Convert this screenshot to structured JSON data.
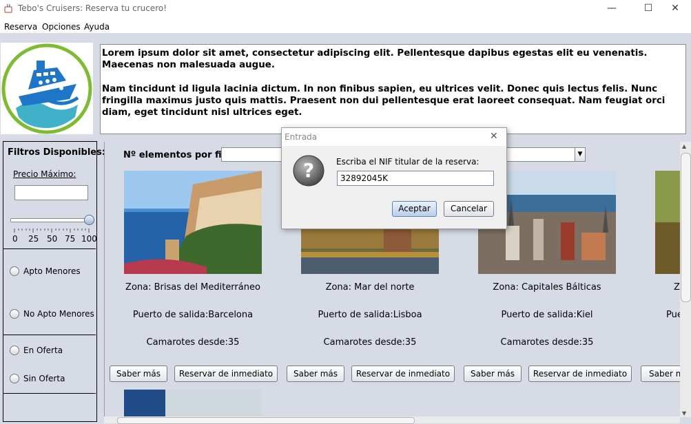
{
  "window": {
    "title": "Tebo's Cruisers: Reserva tu crucero!",
    "minimize": "—",
    "maximize": "☐",
    "close": "✕"
  },
  "menu": [
    "Reserva",
    "Opciones",
    "Ayuda"
  ],
  "description": [
    "Lorem ipsum dolor sit amet, consectetur adipiscing elit. Pellentesque dapibus egestas elit eu venenatis. Maecenas non malesuada augue.",
    "Nam tincidunt id ligula lacinia dictum. In non finibus sapien, eu ultrices velit. Donec quis lectus felis. Nunc fringilla maximus justo quis mattis. Praesent non dui pellentesque erat laoreet consequat. Nam feugiat orci diam, eget tincidunt nisl ultrices eget."
  ],
  "filters": {
    "title": "Filtros Disponibles:",
    "price_label": "Precio Máximo:",
    "price_value": "",
    "slider_ticks": [
      "0",
      "25",
      "50",
      "75",
      "100"
    ],
    "slider_value": 100,
    "apto": "Apto Menores",
    "no_apto": "No Apto Menores",
    "en_oferta": "En Oferta",
    "sin_oferta": "Sin Oferta"
  },
  "main": {
    "rows_label": "Nº elementos por fila",
    "rows_value": "",
    "combo_value": ""
  },
  "cards": [
    {
      "zona": "Zona: Brisas del Mediterráneo",
      "puerto": "Puerto de salida:Barcelona",
      "camarotes": "Camarotes desde:35",
      "saber": "Saber más",
      "reservar": "Reservar de inmediato"
    },
    {
      "zona": "Zona: Mar del norte",
      "puerto": "Puerto de salida:Lisboa",
      "camarotes": "Camarotes desde:35",
      "saber": "Saber más",
      "reservar": "Reservar de inmediato"
    },
    {
      "zona": "Zona: Capitales Bálticas",
      "puerto": "Puerto de salida:Kiel",
      "camarotes": "Camarotes desde:35",
      "saber": "Saber más",
      "reservar": "Reservar de inmediato"
    },
    {
      "zona": "Zo",
      "puerto": "Pue",
      "saber": "Saber m"
    }
  ],
  "dialog": {
    "title": "Entrada",
    "close": "✕",
    "prompt": "Escriba el NIF titular de la reserva:",
    "value": "32892045K",
    "ok": "Aceptar",
    "cancel": "Cancelar"
  },
  "colors": {
    "panel_bg": "#d7dbe5",
    "logo_ring": "#7dbb2f",
    "logo_ship": "#1d76c7"
  }
}
